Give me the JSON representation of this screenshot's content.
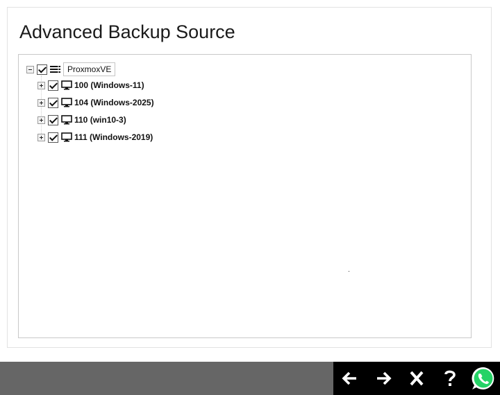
{
  "page": {
    "title": "Advanced Backup Source"
  },
  "tree": {
    "root": {
      "label": "ProxmoxVE",
      "icon": "server-list-icon",
      "expanded": true,
      "checked": true
    },
    "children": [
      {
        "label": "100 (Windows-11)",
        "icon": "monitor-icon",
        "checked": true,
        "expanded": false
      },
      {
        "label": "104 (Windows-2025)",
        "icon": "monitor-icon",
        "checked": true,
        "expanded": false
      },
      {
        "label": "110 (win10-3)",
        "icon": "monitor-icon",
        "checked": true,
        "expanded": false
      },
      {
        "label": "111 (Windows-2019)",
        "icon": "monitor-icon",
        "checked": true,
        "expanded": false
      }
    ]
  },
  "nav": {
    "buttons": [
      {
        "name": "back-button",
        "icon": "arrow-left-icon"
      },
      {
        "name": "next-button",
        "icon": "arrow-right-icon"
      },
      {
        "name": "close-button",
        "icon": "close-x-icon"
      },
      {
        "name": "help-button",
        "icon": "question-mark-icon"
      },
      {
        "name": "whatsapp-button",
        "icon": "whatsapp-icon"
      }
    ]
  },
  "colors": {
    "bottom_bar": "#666666",
    "nav_background": "#000000",
    "whatsapp": "#25D366"
  }
}
